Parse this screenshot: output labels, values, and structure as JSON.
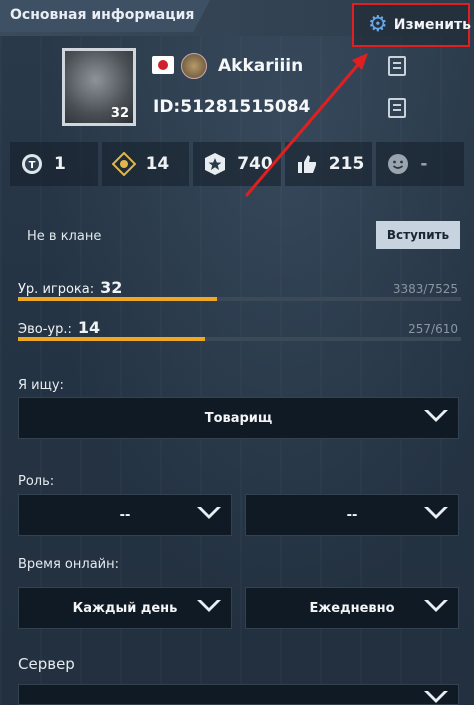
{
  "header": {
    "title": "Основная информация",
    "edit_label": "Изменить"
  },
  "profile": {
    "username": "Akkariiin",
    "id_text": "ID:51281515084",
    "avatar_level": "32"
  },
  "stats": [
    {
      "icon": "token-icon",
      "value": "1"
    },
    {
      "icon": "target-icon",
      "value": "14"
    },
    {
      "icon": "star-badge-icon",
      "value": "740"
    },
    {
      "icon": "thumbs-up-icon",
      "value": "215"
    },
    {
      "icon": "smiley-icon",
      "value": "-"
    }
  ],
  "clan": {
    "status": "Не в клане",
    "join_label": "Вступить"
  },
  "levels": {
    "player": {
      "label": "Ур. игрока:",
      "level": "32",
      "xp": "3383/7525",
      "progress": 0.4496
    },
    "evo": {
      "label": "Эво-ур.:",
      "level": "14",
      "xp": "257/610",
      "progress": 0.4213
    }
  },
  "form": {
    "looking_label": "Я ищу:",
    "looking_value": "Товарищ",
    "role_label": "Роль:",
    "role_value_1": "--",
    "role_value_2": "--",
    "online_label": "Время онлайн:",
    "online_value_1": "Каждый день",
    "online_value_2": "Ежедневно",
    "server_label": "Сервер"
  },
  "colors": {
    "accent_bar": "#f0a821",
    "highlight_border": "#e02020",
    "gear": "#6aa8e6"
  }
}
